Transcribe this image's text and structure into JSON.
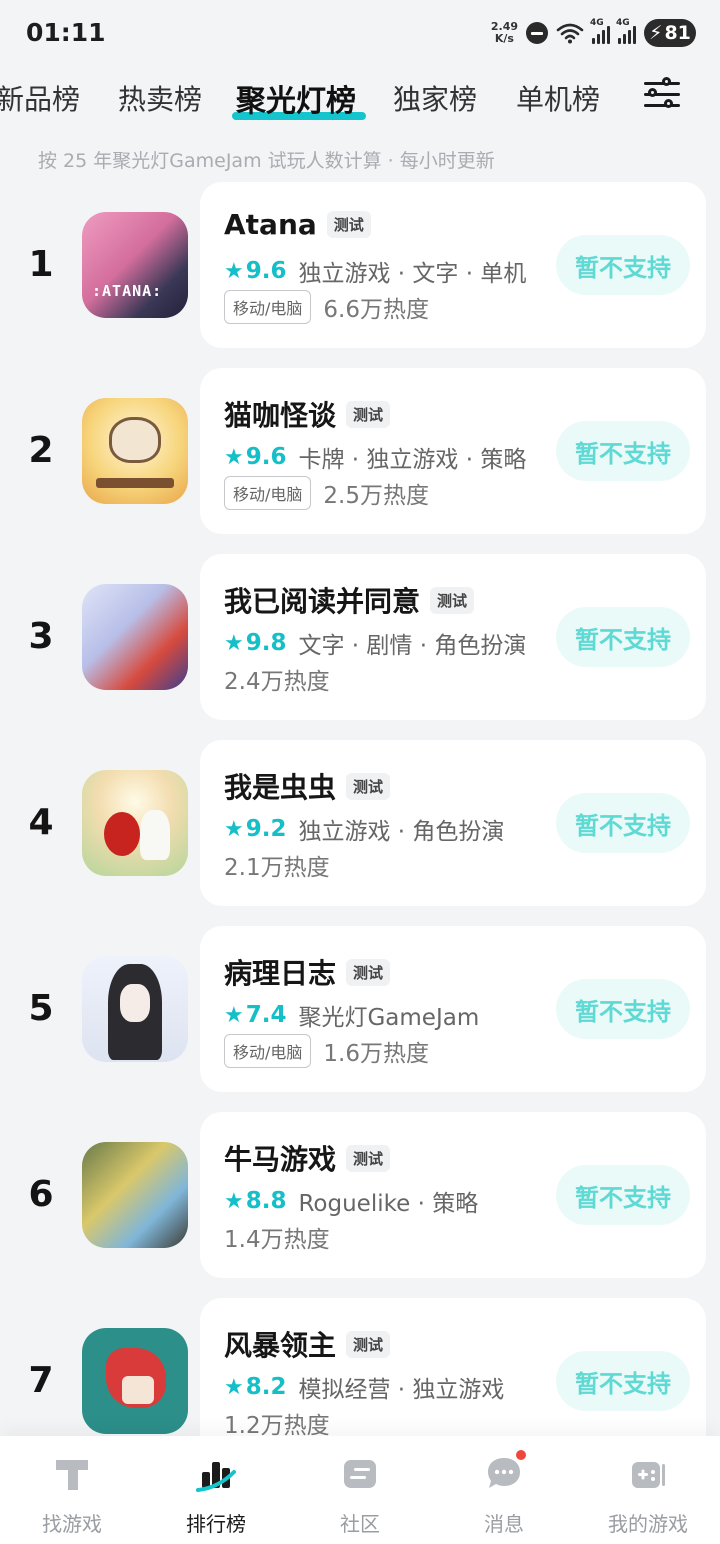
{
  "status_bar": {
    "time": "01:11",
    "net_speed_value": "2.49",
    "net_speed_unit": "K/s",
    "signal_1": "4G",
    "signal_2": "4G",
    "battery": "81"
  },
  "top_tabs": [
    {
      "label": "新品榜",
      "active": false
    },
    {
      "label": "热卖榜",
      "active": false
    },
    {
      "label": "聚光灯榜",
      "active": true
    },
    {
      "label": "独家榜",
      "active": false
    },
    {
      "label": "单机榜",
      "active": false
    }
  ],
  "subtitle": "按 25 年聚光灯GameJam 试玩人数计算 · 每小时更新",
  "badge_test_label": "测试",
  "no_support_label": "暂不支持",
  "games": [
    {
      "rank": "1",
      "name": "Atana",
      "score": "9.6",
      "tags": "独立游戏 · 文字 · 单机",
      "platform": "移动/电脑",
      "heat": "6.6万热度"
    },
    {
      "rank": "2",
      "name": "猫咖怪谈",
      "score": "9.6",
      "tags": "卡牌 · 独立游戏 · 策略",
      "platform": "移动/电脑",
      "heat": "2.5万热度"
    },
    {
      "rank": "3",
      "name": "我已阅读并同意",
      "score": "9.8",
      "tags": "文字 · 剧情 · 角色扮演",
      "platform": "",
      "heat": "2.4万热度"
    },
    {
      "rank": "4",
      "name": "我是虫虫",
      "score": "9.2",
      "tags": "独立游戏 · 角色扮演",
      "platform": "",
      "heat": "2.1万热度"
    },
    {
      "rank": "5",
      "name": "病理日志",
      "score": "7.4",
      "tags": "聚光灯GameJam",
      "platform": "移动/电脑",
      "heat": "1.6万热度"
    },
    {
      "rank": "6",
      "name": "牛马游戏",
      "score": "8.8",
      "tags": "Roguelike · 策略",
      "platform": "",
      "heat": "1.4万热度"
    },
    {
      "rank": "7",
      "name": "风暴领主",
      "score": "8.2",
      "tags": "模拟经营 · 独立游戏",
      "platform": "",
      "heat": "1.2万热度"
    }
  ],
  "bottom_nav": [
    {
      "label": "找游戏",
      "icon": "find-game-icon",
      "active": false
    },
    {
      "label": "排行榜",
      "icon": "ranking-icon",
      "active": true
    },
    {
      "label": "社区",
      "icon": "community-icon",
      "active": false
    },
    {
      "label": "消息",
      "icon": "message-icon",
      "active": false,
      "has_dot": true
    },
    {
      "label": "我的游戏",
      "icon": "my-games-icon",
      "active": false
    }
  ],
  "colors": {
    "accent": "#14bfc8",
    "no_support_bg": "#eafaf9",
    "no_support_text": "#5fd9d3",
    "badge_dot": "#f0473c"
  }
}
